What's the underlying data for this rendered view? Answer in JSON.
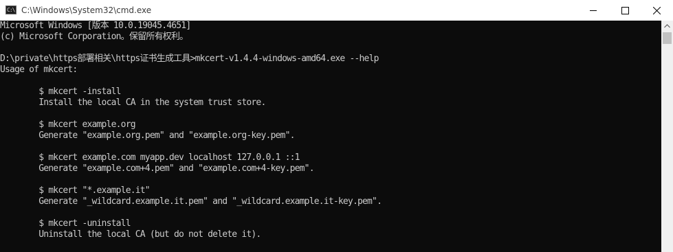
{
  "window": {
    "title": "C:\\Windows\\System32\\cmd.exe",
    "icon": "cmd-app-icon",
    "icon_text": "C:\\",
    "controls": [
      "minimize-icon",
      "maximize-icon",
      "close-icon"
    ]
  },
  "console": {
    "background": "#0c0c0c",
    "foreground": "#cccccc",
    "lines": [
      "Microsoft Windows [版本 10.0.19045.4651]",
      "(c) Microsoft Corporation。保留所有权利。",
      "",
      "D:\\private\\https部署相关\\https证书生成工具>mkcert-v1.4.4-windows-amd64.exe --help",
      "Usage of mkcert:",
      "",
      "        $ mkcert -install",
      "        Install the local CA in the system trust store.",
      "",
      "        $ mkcert example.org",
      "        Generate \"example.org.pem\" and \"example.org-key.pem\".",
      "",
      "        $ mkcert example.com myapp.dev localhost 127.0.0.1 ::1",
      "        Generate \"example.com+4.pem\" and \"example.com+4-key.pem\".",
      "",
      "        $ mkcert \"*.example.it\"",
      "        Generate \"_wildcard.example.it.pem\" and \"_wildcard.example.it-key.pem\".",
      "",
      "        $ mkcert -uninstall",
      "        Uninstall the local CA (but do not delete it)."
    ]
  }
}
